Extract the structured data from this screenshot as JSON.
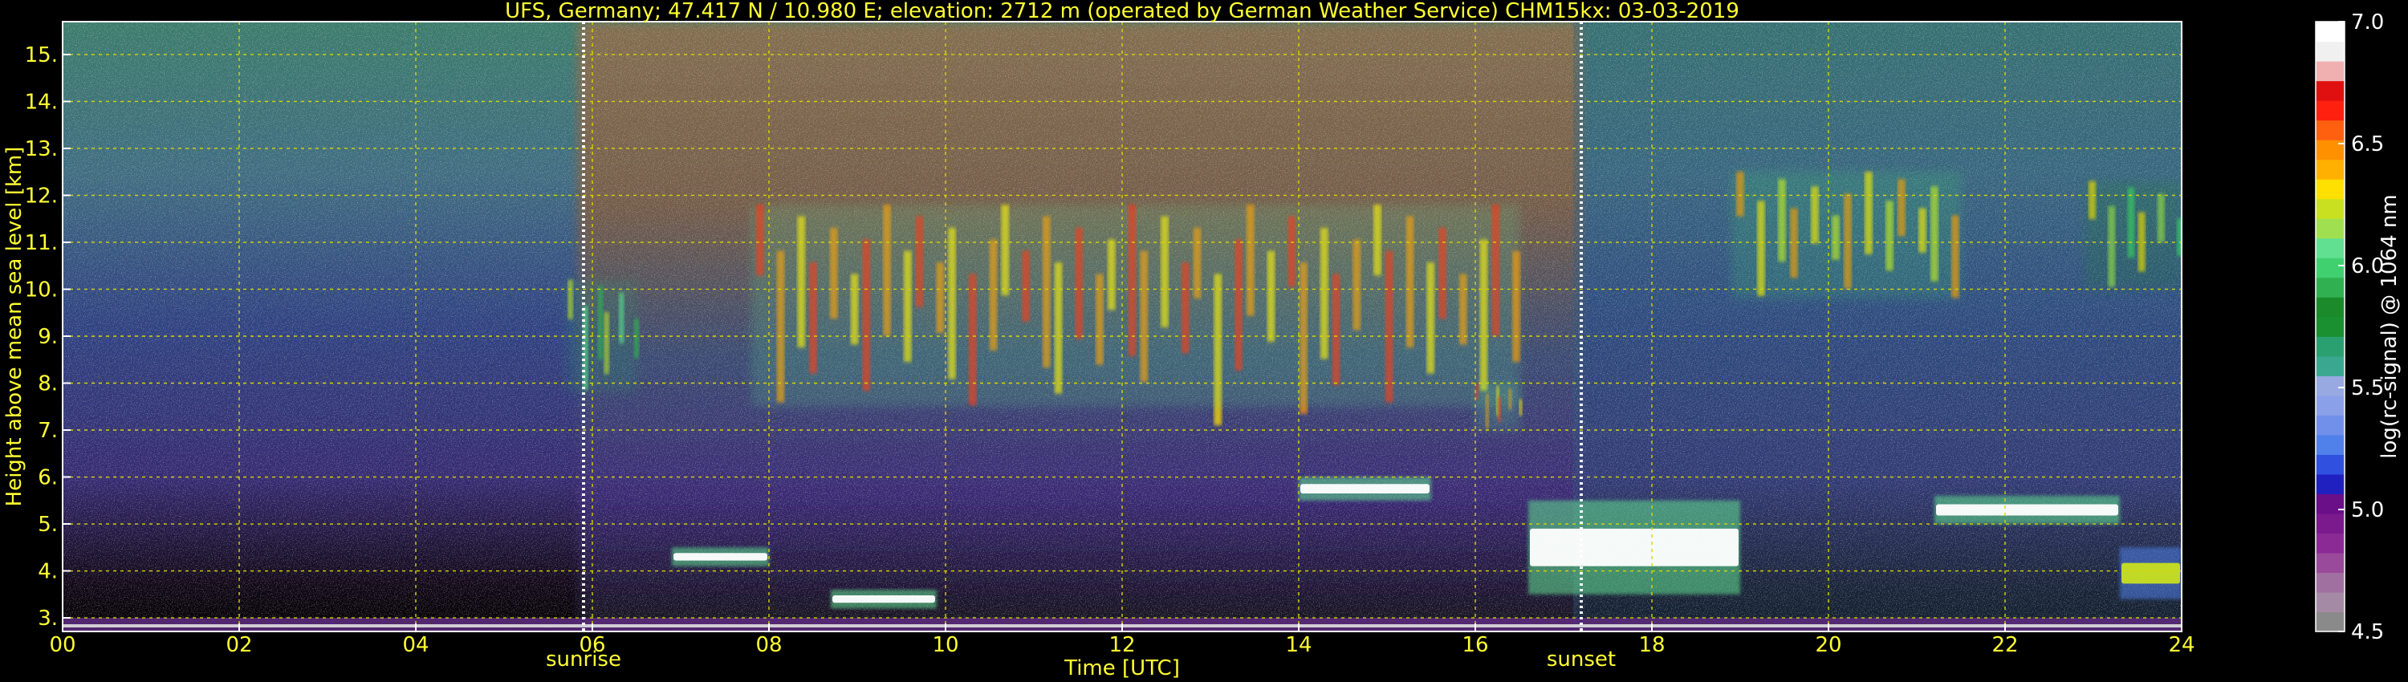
{
  "chart_data": {
    "type": "heatmap",
    "title": "UFS, Germany; 47.417 N / 10.980 E; elevation: 2712 m  (operated by German Weather Service)    CHM15kx: 03-03-2019",
    "xlabel": "Time [UTC]",
    "ylabel": "Height above mean sea level [km]",
    "xlim": [
      0,
      24
    ],
    "ylim": [
      2.71,
      15.7
    ],
    "x_tick_labels": [
      "00",
      "02",
      "04",
      "06",
      "08",
      "10",
      "12",
      "14",
      "16",
      "18",
      "20",
      "22",
      "24"
    ],
    "x_ticks": [
      0,
      2,
      4,
      6,
      8,
      10,
      12,
      14,
      16,
      18,
      20,
      22,
      24
    ],
    "y_tick_labels": [
      "3.",
      "4.",
      "5.",
      "6.",
      "7.",
      "8.",
      "9.",
      "10.",
      "11.",
      "12.",
      "13.",
      "14.",
      "15."
    ],
    "y_ticks": [
      3,
      4,
      5,
      6,
      7,
      8,
      9,
      10,
      11,
      12,
      13,
      14,
      15
    ],
    "grid": true,
    "markers": [
      {
        "label": "sunrise",
        "time": 5.9
      },
      {
        "label": "sunset",
        "time": 17.2
      }
    ],
    "colorbar": {
      "label": "log(rc-signal) @ 1064 nm",
      "min": 4.5,
      "max": 7.0,
      "tick_labels": [
        "4.5",
        "5.0",
        "5.5",
        "6.0",
        "6.5",
        "7.0"
      ],
      "ticks": [
        4.5,
        5.0,
        5.5,
        6.0,
        6.5,
        7.0
      ],
      "colors": [
        "#8a8a8a",
        "#a58aa5",
        "#a070a0",
        "#9a4a9a",
        "#8c2a95",
        "#7a1a8c",
        "#6a0f87",
        "#2020c0",
        "#3050e0",
        "#5080ea",
        "#7090ea",
        "#8aa0e8",
        "#98a8e0",
        "#3aa890",
        "#2aa070",
        "#1a9030",
        "#1a8a2a",
        "#30b050",
        "#40d070",
        "#60e090",
        "#a0e050",
        "#c8e020",
        "#ffe000",
        "#ffb000",
        "#ff9000",
        "#ff6010",
        "#ff2010",
        "#e01010",
        "#f0b0b0",
        "#f0f0f0",
        "#ffffff"
      ]
    },
    "features": [
      {
        "kind": "cirrus",
        "t0": 5.7,
        "t1": 6.5,
        "h0": 7.8,
        "h1": 10.2,
        "level": 6.2
      },
      {
        "kind": "cirrus",
        "t0": 7.8,
        "t1": 16.5,
        "h0": 7.5,
        "h1": 11.8,
        "level": 6.6
      },
      {
        "kind": "cirrus",
        "t0": 16.0,
        "t1": 16.5,
        "h0": 7.0,
        "h1": 8.0,
        "level": 6.6
      },
      {
        "kind": "cirrus",
        "t0": 18.9,
        "t1": 21.5,
        "h0": 9.8,
        "h1": 12.5,
        "level": 6.5
      },
      {
        "kind": "cirrus",
        "t0": 22.9,
        "t1": 24.0,
        "h0": 10.0,
        "h1": 12.3,
        "level": 6.3
      },
      {
        "kind": "cloud",
        "t0": 6.9,
        "t1": 8.0,
        "h0": 4.1,
        "h1": 4.5,
        "level": 7.0
      },
      {
        "kind": "cloud",
        "t0": 8.7,
        "t1": 9.9,
        "h0": 3.2,
        "h1": 3.6,
        "level": 7.0
      },
      {
        "kind": "cloud",
        "t0": 14.0,
        "t1": 15.5,
        "h0": 5.5,
        "h1": 6.0,
        "level": 7.0
      },
      {
        "kind": "cloud",
        "t0": 16.6,
        "t1": 19.0,
        "h0": 3.5,
        "h1": 5.5,
        "level": 7.0
      },
      {
        "kind": "cloud",
        "t0": 21.2,
        "t1": 23.3,
        "h0": 5.0,
        "h1": 5.6,
        "level": 7.0
      },
      {
        "kind": "cloud",
        "t0": 23.3,
        "t1": 24.0,
        "h0": 3.4,
        "h1": 4.5,
        "level": 6.2
      }
    ]
  }
}
